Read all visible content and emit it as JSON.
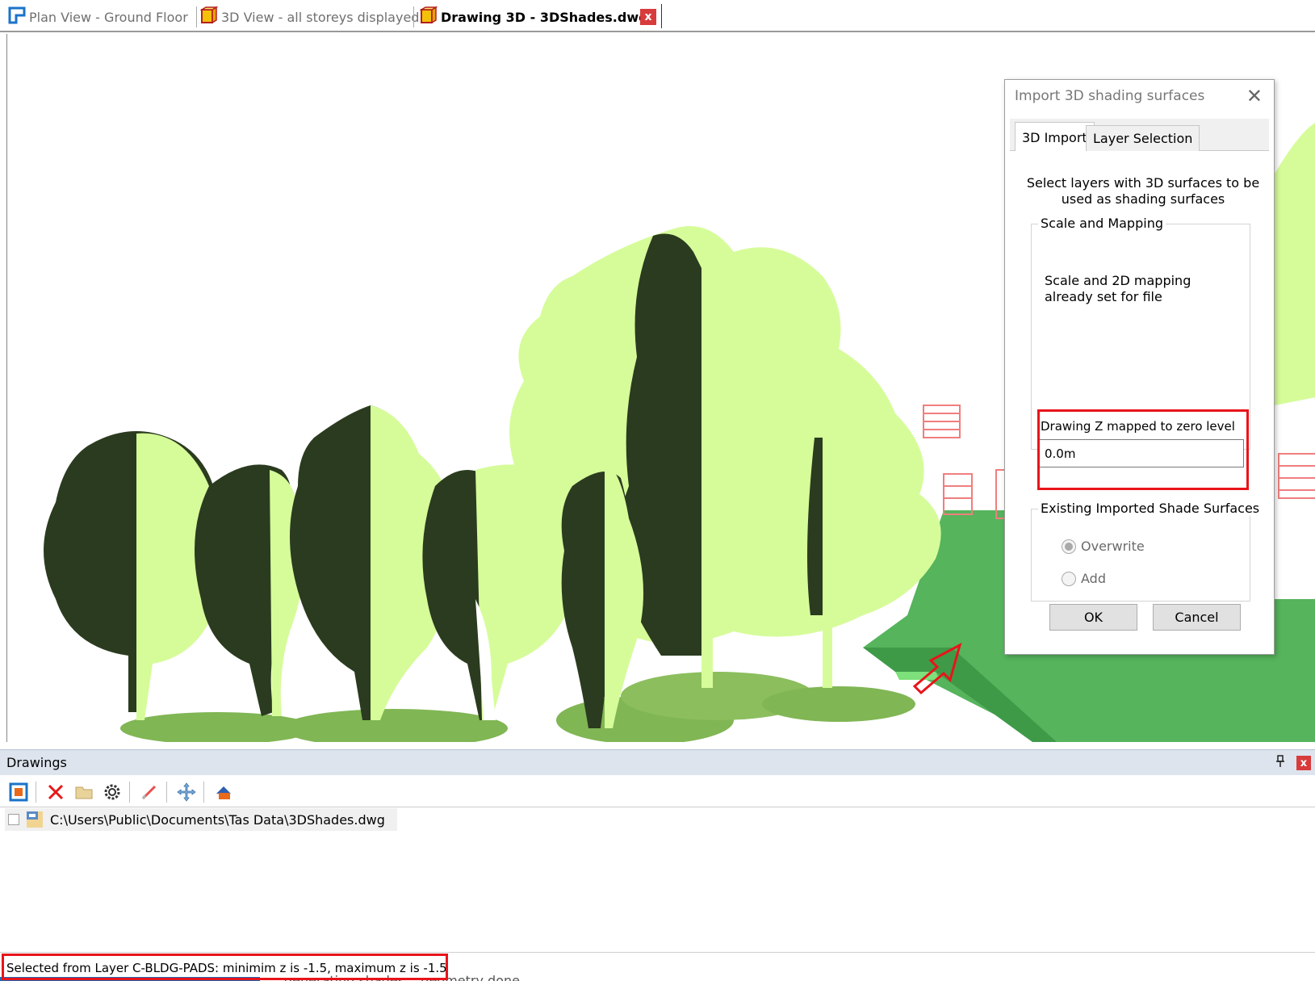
{
  "tabs": [
    {
      "label": "Plan View - Ground Floor",
      "icon": "plan-view-icon",
      "active": false
    },
    {
      "label": "3D View - all storeys displayed",
      "icon": "3d-view-icon",
      "active": false
    },
    {
      "label": "Drawing 3D - 3DShades.dwg",
      "icon": "3d-drawing-icon",
      "active": true
    }
  ],
  "tab_close_label": "x",
  "dialog": {
    "title": "Import 3D shading surfaces",
    "close_label": "✕",
    "tabs": [
      "3D Import",
      "Layer Selection"
    ],
    "instructions": "Select layers with 3D surfaces to be used as shading surfaces",
    "scale_group": {
      "legend": "Scale and Mapping",
      "text": "Scale and 2D mapping already set for file",
      "z_label": "Drawing Z mapped to zero level",
      "z_value": "0.0m"
    },
    "existing_group": {
      "legend": "Existing Imported Shade Surfaces",
      "options": [
        {
          "label": "Overwrite",
          "checked": true
        },
        {
          "label": "Add",
          "checked": false
        }
      ]
    },
    "ok_label": "OK",
    "cancel_label": "Cancel"
  },
  "drawings_panel": {
    "title": "Drawings",
    "pin_label": "📌",
    "close_label": "x",
    "toolbar_icons": [
      "add-drawing-icon",
      "delete-icon",
      "open-folder-icon",
      "settings-gear-icon",
      "pen-icon",
      "move-icon",
      "import-shades-icon"
    ],
    "items": [
      {
        "path": "C:\\Users\\Public\\Documents\\Tas Data\\3DShades.dwg",
        "checked": false
      }
    ]
  },
  "status": {
    "text": "Selected from Layer C-BLDG-PADS: minimim z is -1.5, maximum z is -1.5",
    "ghost_text": "generating shades... geometry done"
  },
  "colors": {
    "foliage_light": "#d6fc9a",
    "foliage_dark": "#2b3b1f",
    "ground_pad": "#55b45c",
    "shadow_ellipse": "#80b654",
    "shade_red": "#f07e7e",
    "highlight_red": "#e8141a"
  }
}
